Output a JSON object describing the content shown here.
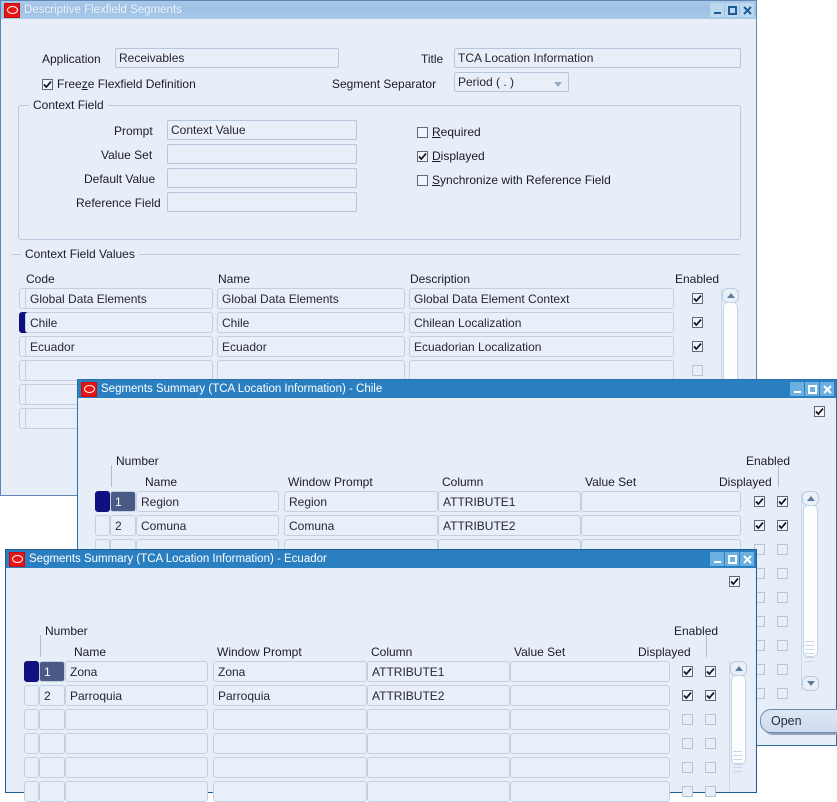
{
  "main_window": {
    "title": "Descriptive Flexfield Segments",
    "icon": "oracle-logo-icon",
    "buttons": {
      "minimize": "minimize",
      "maximize": "maximize",
      "close": "close"
    },
    "fields": {
      "application_label": "Application",
      "application_value": "Receivables",
      "title_label": "Title",
      "title_value": "TCA Location Information",
      "freeze_label": "Freeze Flexfield Definition",
      "freeze_checked": true,
      "separator_label": "Segment Separator",
      "separator_value": "Period ( . )"
    },
    "context_field": {
      "group_title": "Context Field",
      "prompt_label": "Prompt",
      "prompt_value": "Context Value",
      "value_set_label": "Value Set",
      "value_set_value": "",
      "default_value_label": "Default Value",
      "default_value_value": "",
      "reference_field_label": "Reference Field",
      "reference_field_value": "",
      "required_label": "Required",
      "required_checked": false,
      "displayed_label": "Displayed",
      "displayed_checked": true,
      "synchronize_label": "Synchronize with Reference Field",
      "synchronize_checked": false
    },
    "context_values": {
      "group_title": "Context Field Values",
      "columns": [
        "Code",
        "Name",
        "Description",
        "Enabled"
      ],
      "rows": [
        {
          "code": "Global Data Elements",
          "name": "Global Data Elements",
          "description": "Global Data Element Context",
          "enabled": true,
          "selected": false
        },
        {
          "code": "Chile",
          "name": "Chile",
          "description": "Chilean Localization",
          "enabled": true,
          "selected": true
        },
        {
          "code": "Ecuador",
          "name": "Ecuador",
          "description": "Ecuadorian Localization",
          "enabled": true,
          "selected": false
        },
        {
          "code": "",
          "name": "",
          "description": "",
          "enabled": false,
          "selected": false
        },
        {
          "code": "",
          "name": "",
          "description": "",
          "enabled": false,
          "selected": false
        },
        {
          "code": "",
          "name": "",
          "description": "",
          "enabled": false,
          "selected": false
        }
      ]
    }
  },
  "chile_window": {
    "title": "Segments Summary (TCA Location Information) - Chile",
    "icon": "oracle-logo-icon",
    "top_checkbox_checked": true,
    "headers": {
      "number": "Number",
      "name": "Name",
      "window_prompt": "Window Prompt",
      "column": "Column",
      "value_set": "Value Set",
      "displayed": "Displayed",
      "enabled": "Enabled"
    },
    "rows": [
      {
        "number": "1",
        "name": "Region",
        "window_prompt": "Region",
        "column": "ATTRIBUTE1",
        "value_set": "",
        "displayed": true,
        "enabled": true,
        "selected": true
      },
      {
        "number": "2",
        "name": "Comuna",
        "window_prompt": "Comuna",
        "column": "ATTRIBUTE2",
        "value_set": "",
        "displayed": true,
        "enabled": true,
        "selected": false
      },
      {
        "number": "",
        "name": "",
        "window_prompt": "",
        "column": "",
        "value_set": "",
        "displayed": false,
        "enabled": false,
        "selected": false
      },
      {
        "number": "",
        "name": "",
        "window_prompt": "",
        "column": "",
        "value_set": "",
        "displayed": false,
        "enabled": false,
        "selected": false
      },
      {
        "number": "",
        "name": "",
        "window_prompt": "",
        "column": "",
        "value_set": "",
        "displayed": false,
        "enabled": false,
        "selected": false
      },
      {
        "number": "",
        "name": "",
        "window_prompt": "",
        "column": "",
        "value_set": "",
        "displayed": false,
        "enabled": false,
        "selected": false
      },
      {
        "number": "",
        "name": "",
        "window_prompt": "",
        "column": "",
        "value_set": "",
        "displayed": false,
        "enabled": false,
        "selected": false
      },
      {
        "number": "",
        "name": "",
        "window_prompt": "",
        "column": "",
        "value_set": "",
        "displayed": false,
        "enabled": false,
        "selected": false
      },
      {
        "number": "",
        "name": "",
        "window_prompt": "",
        "column": "",
        "value_set": "",
        "displayed": false,
        "enabled": false,
        "selected": false
      }
    ],
    "open_button_label": "Open"
  },
  "ecuador_window": {
    "title": "Segments Summary (TCA Location Information) - Ecuador",
    "icon": "oracle-logo-icon",
    "top_checkbox_checked": true,
    "headers": {
      "number": "Number",
      "name": "Name",
      "window_prompt": "Window Prompt",
      "column": "Column",
      "value_set": "Value Set",
      "displayed": "Displayed",
      "enabled": "Enabled"
    },
    "rows": [
      {
        "number": "1",
        "name": "Zona",
        "window_prompt": "Zona",
        "column": "ATTRIBUTE1",
        "value_set": "",
        "displayed": true,
        "enabled": true,
        "selected": true
      },
      {
        "number": "2",
        "name": "Parroquia",
        "window_prompt": "Parroquia",
        "column": "ATTRIBUTE2",
        "value_set": "",
        "displayed": true,
        "enabled": true,
        "selected": false
      },
      {
        "number": "",
        "name": "",
        "window_prompt": "",
        "column": "",
        "value_set": "",
        "displayed": false,
        "enabled": false,
        "selected": false
      },
      {
        "number": "",
        "name": "",
        "window_prompt": "",
        "column": "",
        "value_set": "",
        "displayed": false,
        "enabled": false,
        "selected": false
      },
      {
        "number": "",
        "name": "",
        "window_prompt": "",
        "column": "",
        "value_set": "",
        "displayed": false,
        "enabled": false,
        "selected": false
      },
      {
        "number": "",
        "name": "",
        "window_prompt": "",
        "column": "",
        "value_set": "",
        "displayed": false,
        "enabled": false,
        "selected": false
      }
    ]
  },
  "colors": {
    "window_face": "#e8eef7",
    "active_titlebar": "#2a7fc1",
    "inactive_titlebar": "#a9c9e8",
    "selection": "#101080",
    "field_border": "#b6c6dc"
  }
}
